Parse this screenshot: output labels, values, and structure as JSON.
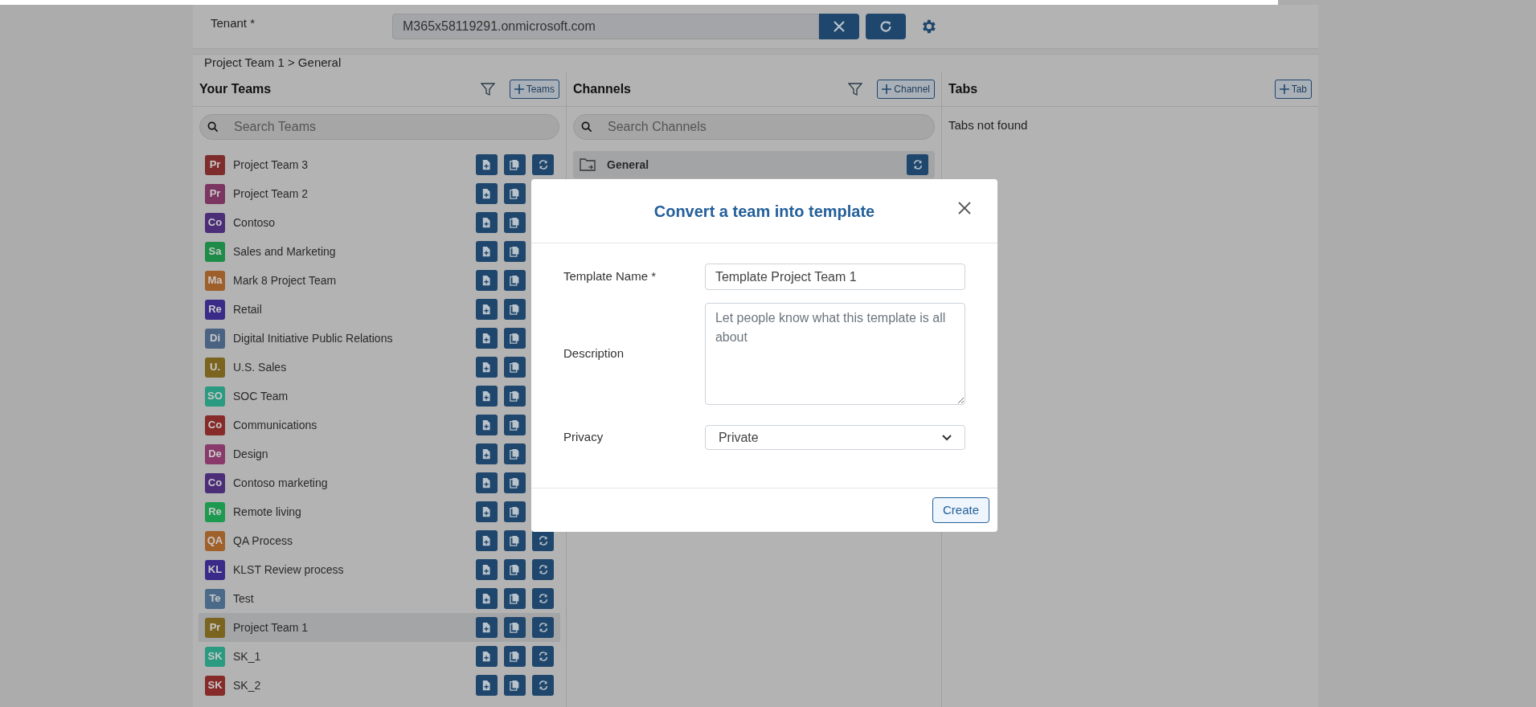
{
  "tenant": {
    "label": "Tenant *",
    "value": "M365x58119291.onmicrosoft.com"
  },
  "breadcrumb": "Project Team 1 > General",
  "teams_panel": {
    "title": "Your Teams",
    "add_button": "Teams",
    "search_placeholder": "Search Teams",
    "items": [
      {
        "initials": "Pr",
        "name": "Project Team 3",
        "color": "#7e2c2c",
        "selected": false
      },
      {
        "initials": "Pr",
        "name": "Project Team 2",
        "color": "#7c3461",
        "selected": false
      },
      {
        "initials": "Co",
        "name": "Contoso",
        "color": "#4b2d78",
        "selected": false
      },
      {
        "initials": "Sa",
        "name": "Sales and Marketing",
        "color": "#1f8b48",
        "selected": false
      },
      {
        "initials": "Ma",
        "name": "Mark 8 Project Team",
        "color": "#9e5f2b",
        "selected": false
      },
      {
        "initials": "Re",
        "name": "Retail",
        "color": "#3a2b88",
        "selected": false
      },
      {
        "initials": "Di",
        "name": "Digital Initiative Public Relations",
        "color": "#4b6382",
        "selected": false
      },
      {
        "initials": "U.",
        "name": "U.S. Sales",
        "color": "#7a6420",
        "selected": false
      },
      {
        "initials": "SO",
        "name": "SOC Team",
        "color": "#2a9a80",
        "selected": false
      },
      {
        "initials": "Co",
        "name": "Communications",
        "color": "#862a2a",
        "selected": false
      },
      {
        "initials": "De",
        "name": "Design",
        "color": "#8a3a6a",
        "selected": false
      },
      {
        "initials": "Co",
        "name": "Contoso marketing",
        "color": "#4b2d78",
        "selected": false
      },
      {
        "initials": "Re",
        "name": "Remote living",
        "color": "#1e9a50",
        "selected": false
      },
      {
        "initials": "QA",
        "name": "QA Process",
        "color": "#a0602a",
        "selected": false
      },
      {
        "initials": "KL",
        "name": "KLST Review process",
        "color": "#3a2b88",
        "selected": false
      },
      {
        "initials": "Te",
        "name": "Test",
        "color": "#4b6a8a",
        "selected": false
      },
      {
        "initials": "Pr",
        "name": "Project Team 1",
        "color": "#7a6420",
        "selected": true
      },
      {
        "initials": "SK",
        "name": "SK_1",
        "color": "#2a9a80",
        "selected": false
      },
      {
        "initials": "SK",
        "name": "SK_2",
        "color": "#862a2a",
        "selected": false
      }
    ]
  },
  "channels_panel": {
    "title": "Channels",
    "add_button": "Channel",
    "search_placeholder": "Search Channels",
    "items": [
      {
        "name": "General",
        "selected": true
      }
    ]
  },
  "tabs_panel": {
    "title": "Tabs",
    "add_button": "Tab",
    "empty_message": "Tabs not found"
  },
  "dialog": {
    "title": "Convert a team into template",
    "fields": [
      {
        "kind": "text",
        "label": "Template Name *",
        "value": "Template Project Team 1"
      },
      {
        "kind": "textarea",
        "label": "Description",
        "placeholder": "Let people know what this template is all about"
      },
      {
        "kind": "select",
        "label": "Privacy",
        "value": "Private"
      }
    ],
    "create_button": "Create"
  }
}
